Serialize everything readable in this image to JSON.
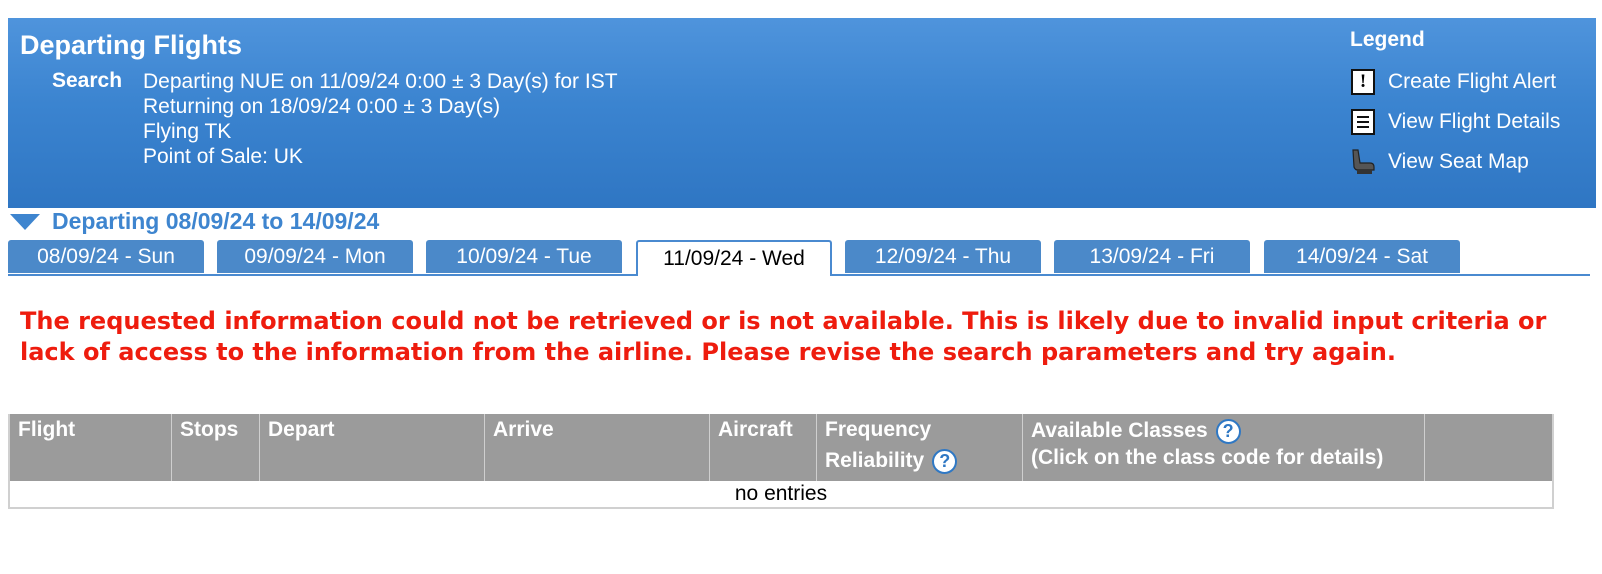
{
  "header": {
    "title": "Departing Flights",
    "search_label": "Search",
    "search_lines": [
      "Departing NUE on 11/09/24 0:00 ± 3 Day(s) for IST",
      "Returning on 18/09/24 0:00 ± 3 Day(s)",
      "Flying TK",
      "Point of Sale: UK"
    ]
  },
  "legend": {
    "title": "Legend",
    "items": [
      {
        "icon": "flight-alert-icon",
        "label": "Create Flight Alert"
      },
      {
        "icon": "flight-details-icon",
        "label": "View Flight Details"
      },
      {
        "icon": "seat-map-icon",
        "label": "View Seat Map"
      }
    ]
  },
  "departing": {
    "heading": "Departing 08/09/24 to 14/09/24",
    "tabs": [
      "08/09/24 - Sun",
      "09/09/24 - Mon",
      "10/09/24 - Tue",
      "11/09/24 - Wed",
      "12/09/24 - Thu",
      "13/09/24 - Fri",
      "14/09/24 - Sat"
    ],
    "active_tab": "11/09/24 - Wed"
  },
  "error_message": "The requested information could not be retrieved or is not available. This is likely due to invalid input criteria or lack of access to the information from the airline. Please revise the search parameters and try again.",
  "table": {
    "columns": {
      "flight": "Flight",
      "stops": "Stops",
      "depart": "Depart",
      "arrive": "Arrive",
      "aircraft": "Aircraft",
      "frequency": "Frequency",
      "reliability": "Reliability",
      "available_classes": "Available Classes",
      "class_hint": "(Click on the class code for details)",
      "extra": ""
    },
    "empty_text": "no entries"
  },
  "colors": {
    "header_blue": "#3b84d0",
    "tab_blue": "#4b89c9",
    "error_red": "#ee1c0e",
    "table_header_gray": "#9b9b9b"
  }
}
